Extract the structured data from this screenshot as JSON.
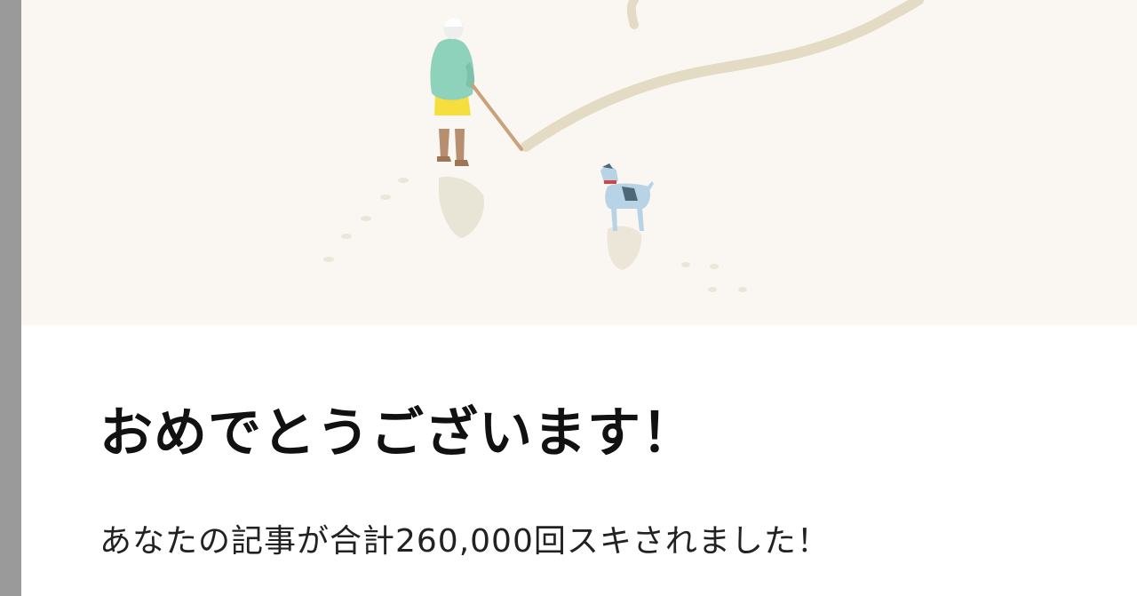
{
  "notification": {
    "title": "おめでとうございます！",
    "message": "あなたの記事が合計260,000回スキされました！"
  },
  "illustration": {
    "background_color": "#faf6f1",
    "icons": [
      "person-walking-icon",
      "dog-icon",
      "path-icon"
    ],
    "colors": {
      "shirt": "#8ed2bb",
      "shorts": "#f6df3d",
      "path": "#e4dbc5",
      "dog": "#b8d3e6",
      "collar": "#d64545"
    }
  }
}
